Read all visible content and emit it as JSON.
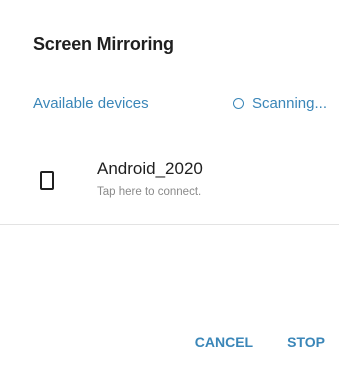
{
  "dialog": {
    "title": "Screen Mirroring"
  },
  "devices_section": {
    "label": "Available devices",
    "status_text": "Scanning...",
    "status_icon": "spinner-icon"
  },
  "devices": [
    {
      "icon": "phone-icon",
      "name": "Android_2020",
      "subtitle": "Tap here to connect."
    }
  ],
  "actions": {
    "cancel_label": "CANCEL",
    "stop_label": "STOP"
  },
  "colors": {
    "accent": "#3a86b8",
    "text_primary": "#1f1f1f",
    "text_secondary": "#8a8a8a"
  }
}
